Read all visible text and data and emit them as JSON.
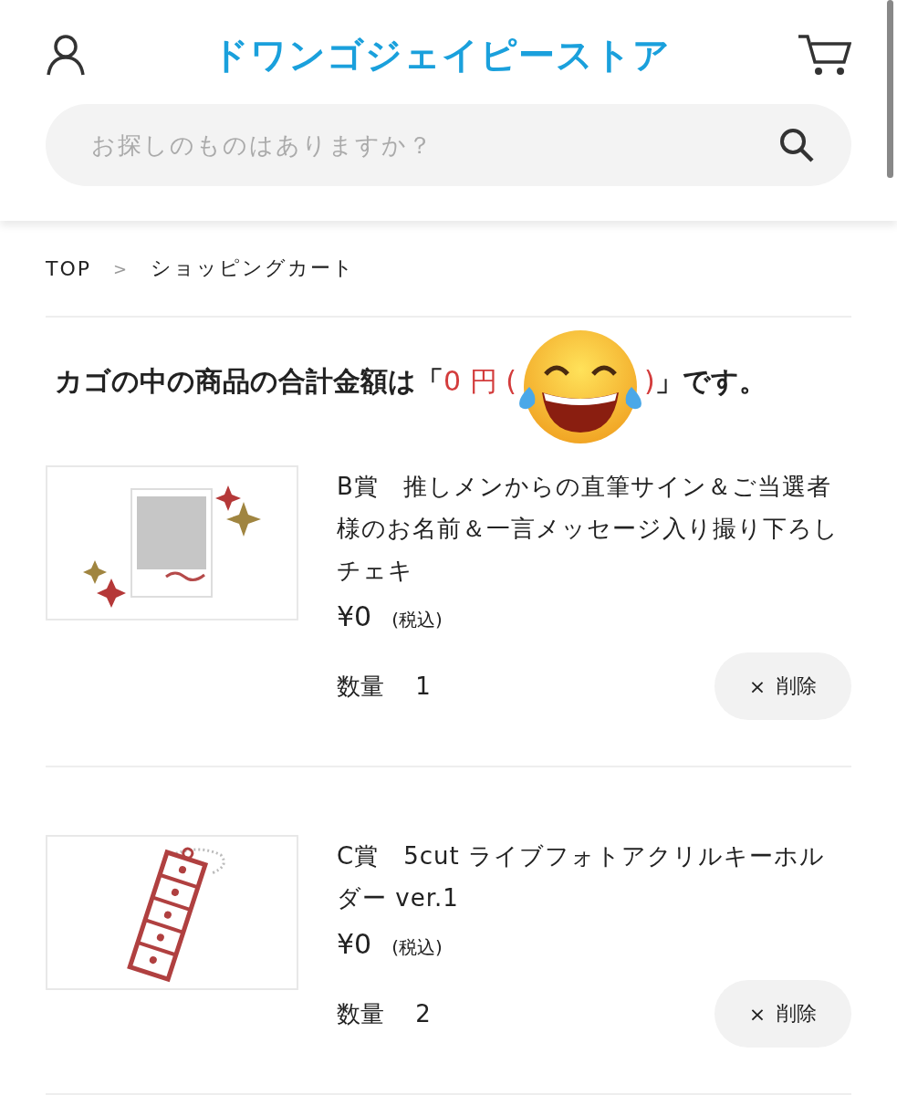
{
  "header": {
    "logo": "ドワンゴジェイピーストア"
  },
  "search": {
    "placeholder": "お探しのものはありますか？"
  },
  "breadcrumb": {
    "items": [
      "TOP",
      "ショッピングカート"
    ],
    "separator": ">"
  },
  "total": {
    "before": "カゴの中の商品の合計金額は「",
    "amount": "0 円 (",
    "amount_close": ")",
    "after": "」です。"
  },
  "items": [
    {
      "title": "B賞　推しメンからの直筆サイン＆ご当選者様のお名前＆一言メッセージ入り撮り下ろしチェキ",
      "price": "¥0",
      "tax_note": "(税込)",
      "quantity_label": "数量",
      "quantity": "1",
      "delete": {
        "icon": "×",
        "label": "削除"
      }
    },
    {
      "title": "C賞　5cut ライブフォトアクリルキーホルダー ver.1",
      "price": "¥0",
      "tax_note": "(税込)",
      "quantity_label": "数量",
      "quantity": "2",
      "delete": {
        "icon": "×",
        "label": "削除"
      }
    }
  ]
}
